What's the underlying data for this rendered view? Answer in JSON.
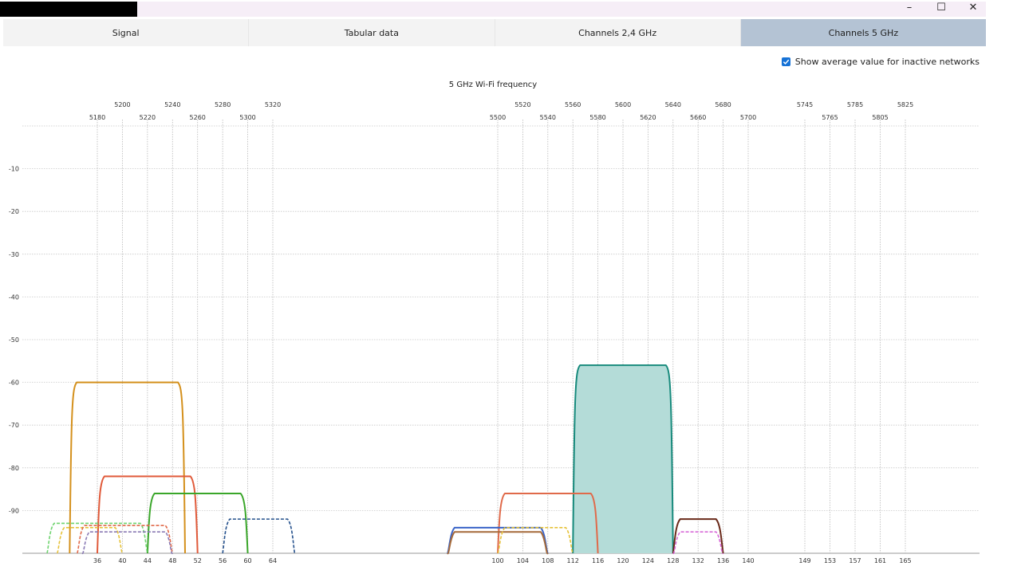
{
  "window": {
    "controls": {
      "minimize": "–",
      "maximize": "☐",
      "close": "✕"
    }
  },
  "tabs": [
    {
      "label": "Signal",
      "active": false
    },
    {
      "label": "Tabular data",
      "active": false
    },
    {
      "label": "Channels 2,4 GHz",
      "active": false
    },
    {
      "label": "Channels 5 GHz",
      "active": true
    }
  ],
  "options": {
    "show_average_label": "Show average value for inactive networks",
    "show_average_checked": true
  },
  "chart_data": {
    "type": "area",
    "title": "5 GHz Wi-Fi frequency",
    "ylim": [
      -100,
      0
    ],
    "yticks": [
      -10,
      -20,
      -30,
      -40,
      -50,
      -60,
      -70,
      -80,
      -90
    ],
    "channels": [
      {
        "ch": 36,
        "freq": 5180
      },
      {
        "ch": 40,
        "freq": 5200
      },
      {
        "ch": 44,
        "freq": 5220
      },
      {
        "ch": 48,
        "freq": 5240
      },
      {
        "ch": 52,
        "freq": 5260
      },
      {
        "ch": 56,
        "freq": 5280
      },
      {
        "ch": 60,
        "freq": 5300
      },
      {
        "ch": 64,
        "freq": 5320
      },
      {
        "ch": 100,
        "freq": 5500
      },
      {
        "ch": 104,
        "freq": 5520
      },
      {
        "ch": 108,
        "freq": 5540
      },
      {
        "ch": 112,
        "freq": 5560
      },
      {
        "ch": 116,
        "freq": 5580
      },
      {
        "ch": 120,
        "freq": 5600
      },
      {
        "ch": 124,
        "freq": 5620
      },
      {
        "ch": 128,
        "freq": 5640
      },
      {
        "ch": 132,
        "freq": 5660
      },
      {
        "ch": 136,
        "freq": 5680
      },
      {
        "ch": 140,
        "freq": 5700
      },
      {
        "ch": 149,
        "freq": 5745
      },
      {
        "ch": 153,
        "freq": 5765
      },
      {
        "ch": 157,
        "freq": 5785
      },
      {
        "ch": 161,
        "freq": 5805
      },
      {
        "ch": 165,
        "freq": 5825
      }
    ],
    "series": [
      {
        "from": 30.5,
        "to": 50,
        "level": -60,
        "color": "#d4901c",
        "style": "solid",
        "fill": false
      },
      {
        "from": 36,
        "to": 52,
        "level": -82,
        "color": "#e05a3a",
        "style": "solid",
        "fill": false
      },
      {
        "from": 44,
        "to": 60,
        "level": -86,
        "color": "#3aa62a",
        "style": "solid",
        "fill": false
      },
      {
        "from": 56,
        "to": 68,
        "level": -92,
        "color": "#24508c",
        "style": "dashed",
        "fill": false
      },
      {
        "from": 26,
        "to": 44,
        "level": -93,
        "color": "#6fd36f",
        "style": "dashed",
        "fill": false
      },
      {
        "from": 28,
        "to": 40,
        "level": -94,
        "color": "#e6c23a",
        "style": "dashed",
        "fill": false
      },
      {
        "from": 32,
        "to": 48,
        "level": -93.5,
        "color": "#e06a4a",
        "style": "dashed",
        "fill": false
      },
      {
        "from": 33,
        "to": 48,
        "level": -95,
        "color": "#8a7ab5",
        "style": "dashed",
        "fill": false
      },
      {
        "from": 112,
        "to": 128,
        "level": -56,
        "color": "#178a7c",
        "style": "solid",
        "fill": true,
        "fillColor": "#b4dcd8"
      },
      {
        "from": 100,
        "to": 116,
        "level": -86,
        "color": "#e06a4a",
        "style": "solid",
        "fill": false
      },
      {
        "from": 96,
        "to": 108,
        "level": -94,
        "color": "#3a64c8",
        "style": "solid",
        "fill": false
      },
      {
        "from": 96,
        "to": 108,
        "level": -95,
        "color": "#a56a3a",
        "style": "solid",
        "fill": false
      },
      {
        "from": 100,
        "to": 112,
        "level": -94,
        "color": "#e6c23a",
        "style": "dashed",
        "fill": false
      },
      {
        "from": 128,
        "to": 136,
        "level": -92,
        "color": "#6a2a1a",
        "style": "solid",
        "fill": false
      },
      {
        "from": 128,
        "to": 136,
        "level": -95,
        "color": "#d86ad8",
        "style": "dashed",
        "fill": false
      }
    ]
  }
}
